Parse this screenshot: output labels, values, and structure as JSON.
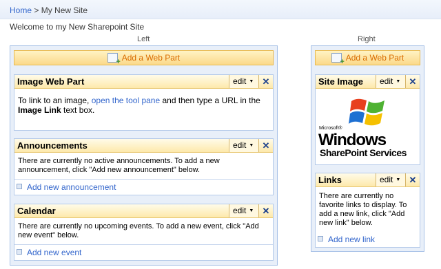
{
  "breadcrumb": {
    "home": "Home",
    "separator": ">",
    "current": "My New Site"
  },
  "welcome_text": "Welcome to my New Sharepoint Site",
  "zones": {
    "left": {
      "label": "Left",
      "add_web_part": "Add a Web Part",
      "parts": {
        "image_web_part": {
          "title": "Image Web Part",
          "edit": "edit",
          "body_prefix": "To link to an image,",
          "body_link": "open the tool pane",
          "body_mid": "and then type a URL in the",
          "body_bold": "Image Link",
          "body_suffix": "text box."
        },
        "announcements": {
          "title": "Announcements",
          "edit": "edit",
          "body": "There are currently no active announcements. To add a new announcement, click \"Add new announcement\" below.",
          "add_link": "Add new announcement"
        },
        "calendar": {
          "title": "Calendar",
          "edit": "edit",
          "body": "There are currently no upcoming events. To add a new event, click \"Add new event\" below.",
          "add_link": "Add new event"
        }
      }
    },
    "right": {
      "label": "Right",
      "add_web_part": "Add a Web Part",
      "parts": {
        "site_image": {
          "title": "Site Image",
          "edit": "edit",
          "logo_small": "Microsoft®",
          "logo_big": "Windows",
          "logo_sub": "SharePoint Services"
        },
        "links": {
          "title": "Links",
          "edit": "edit",
          "body": "There are currently no favorite links to display. To add a new link, click \"Add new link\" below.",
          "add_link": "Add new link"
        }
      }
    }
  },
  "close_glyph": "✕",
  "icons": {
    "add_web_part": "add-web-part-icon",
    "close": "close-icon",
    "dropdown": "dropdown-arrow-icon",
    "bullet": "bullet-icon"
  },
  "colors": {
    "link": "#3366cc",
    "accent_orange": "#d96c00",
    "title_bar": "#fde9ab",
    "zone_border": "#a6c0e6"
  }
}
